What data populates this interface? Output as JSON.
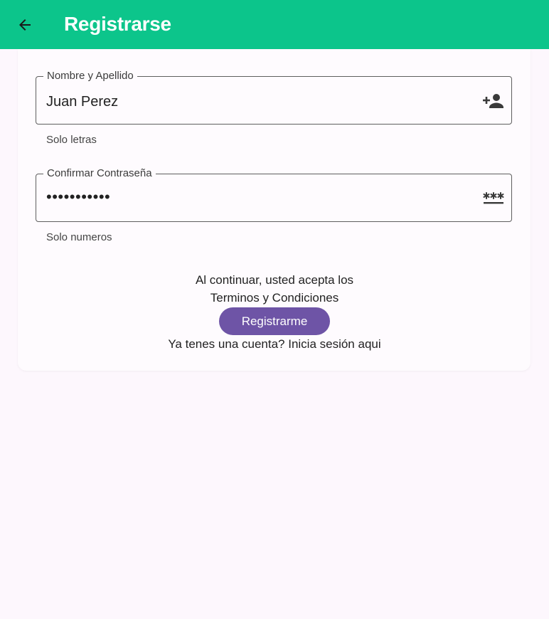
{
  "appbar": {
    "title": "Registrarse",
    "back_icon": "arrow-back-icon",
    "color": "#0cc58b"
  },
  "form": {
    "name_field": {
      "label": "Nombre y Apellido",
      "value": "Juan Perez",
      "helper": "Solo letras",
      "icon": "person-add-icon"
    },
    "password_field": {
      "label": "Confirmar Contraseña",
      "value": "•••••••••••",
      "helper": "Solo numeros",
      "icon": "password-icon"
    },
    "terms_line1": "Al continuar, usted acepta los",
    "terms_line2": "Terminos y Condiciones",
    "register_button": "Registrarme",
    "login_prompt": "Ya tenes una cuenta? Inicia sesión aqui",
    "button_color": "#6e54a6"
  }
}
